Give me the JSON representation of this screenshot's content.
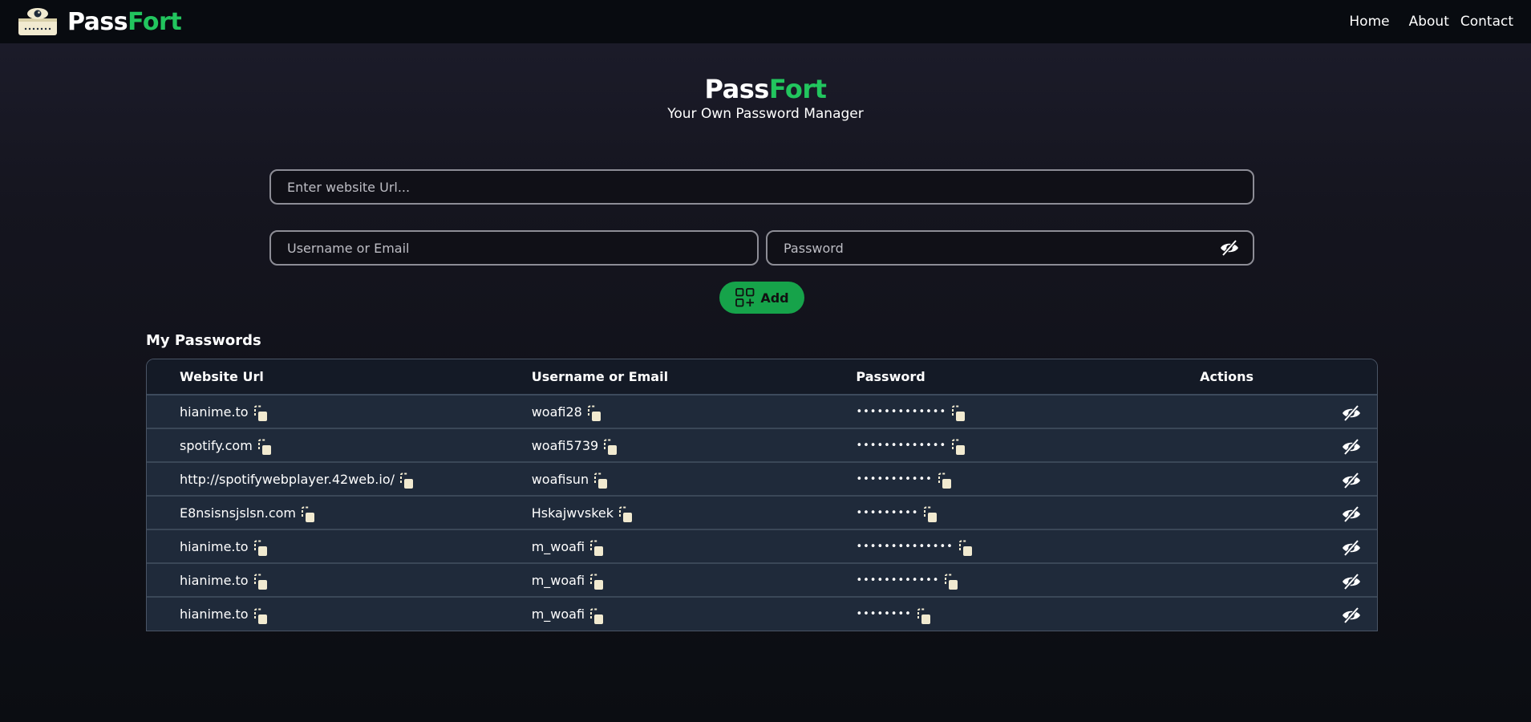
{
  "nav": {
    "brand_prefix": "Pass",
    "brand_suffix": "Fort",
    "links": [
      "Home",
      "About",
      "Contact"
    ]
  },
  "hero": {
    "title_prefix": "Pass",
    "title_suffix": "Fort",
    "subtitle": "Your Own Password Manager"
  },
  "form": {
    "url_placeholder": "Enter website Url...",
    "username_placeholder": "Username or Email",
    "password_placeholder": "Password",
    "add_label": "Add"
  },
  "table": {
    "title": "My Passwords",
    "headers": [
      "Website Url",
      "Username or Email",
      "Password",
      "Actions"
    ],
    "rows": [
      {
        "site": "hianime.to",
        "user": "woafi28",
        "password": "•••••••••••••"
      },
      {
        "site": "spotify.com",
        "user": "woafi5739",
        "password": "•••••••••••••"
      },
      {
        "site": "http://spotifywebplayer.42web.io/",
        "user": "woafisun",
        "password": "•••••••••••"
      },
      {
        "site": "E8nsisnsjslsn.com",
        "user": "Hskajwvskek",
        "password": "•••••••••"
      },
      {
        "site": "hianime.to",
        "user": "m_woafi",
        "password": "••••••••••••••"
      },
      {
        "site": "hianime.to",
        "user": "m_woafi",
        "password": "••••••••••••"
      },
      {
        "site": "hianime.to",
        "user": "m_woafi",
        "password": "••••••••"
      }
    ]
  },
  "colors": {
    "accent": "#22c55e",
    "button": "#16a34a",
    "row_bg": "#1f2a3a",
    "icon_cream": "#f1ead0"
  },
  "icons": {
    "logo": "monitor-eye-logo",
    "copy": "copy-icon",
    "toggle_visibility": "eye-off-icon",
    "edit": "pencil-icon",
    "delete": "trash-icon",
    "add": "grid-plus-icon"
  }
}
